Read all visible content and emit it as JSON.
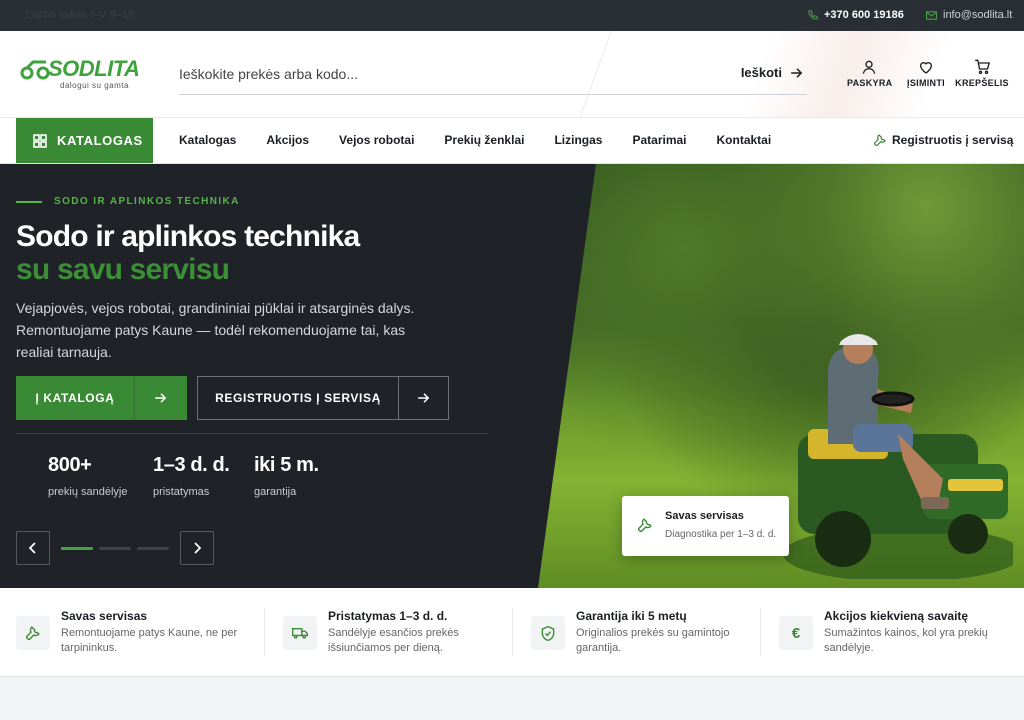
{
  "topbar": {
    "left_text": "Darbo laikas I–V 9–18",
    "phone": "+370 600 19186",
    "email": "info@sodlita.lt"
  },
  "header": {
    "logo_text": "SODLITA",
    "logo_tagline": "dalogui su gamta",
    "search_placeholder": "Ieškokite prekės arba kodo...",
    "search_button": "Ieškoti",
    "account_label": "PASKYRA",
    "wishlist_label": "ĮSIMINTI",
    "cart_label": "KREPŠELIS"
  },
  "nav": {
    "catalog_button": "KATALOGAS",
    "links": [
      "Katalogas",
      "Akcijos",
      "Vejos robotai",
      "Prekių ženklai",
      "Lizingas",
      "Patarimai",
      "Kontaktai"
    ],
    "service_link": "Registruotis į servisą"
  },
  "hero": {
    "kicker": "SODO IR APLINKOS TECHNIKA",
    "title": "Sodo ir aplinkos technika",
    "title_accent": "su savu servisu",
    "description": "Vejapjovės, vejos robotai, grandininiai pjūklai ir atsarginės dalys. Remontuojame patys Kaune — todėl rekomenduojame tai, kas realiai tarnauja.",
    "primary_button": "Į KATALOGĄ",
    "secondary_button": "REGISTRUOTIS Į SERVISĄ",
    "stats": [
      {
        "value": "800+",
        "label": "prekių sandėlyje"
      },
      {
        "value": "1–3 d. d.",
        "label": "pristatymas"
      },
      {
        "value": "iki 5 m.",
        "label": "garantija"
      }
    ],
    "slider_position": "1 of 3",
    "card_title": "Savas servisas",
    "card_subtitle": "Diagnostika per 1–3 d. d."
  },
  "features": [
    {
      "title": "Savas servisas",
      "text": "Remontuojame patys Kaune, ne per tarpininkus.",
      "icon": "wrench-icon"
    },
    {
      "title": "Pristatymas 1–3 d. d.",
      "text": "Sandėlyje esančios prekės išsiunčiamos per dieną.",
      "icon": "truck-icon"
    },
    {
      "title": "Garantija iki 5 metų",
      "text": "Originalios prekės su gamintojo garantija.",
      "icon": "shield-check-icon"
    },
    {
      "title": "Akcijos kiekvieną savaitę",
      "text": "Sumažintos kainos, kol yra prekių sandėlyje.",
      "icon": "euro-icon"
    }
  ],
  "colors": {
    "brand_green": "#3a8a35",
    "accent_green": "#54b547",
    "dark": "#1f2327",
    "topbar": "#2a2f35"
  }
}
